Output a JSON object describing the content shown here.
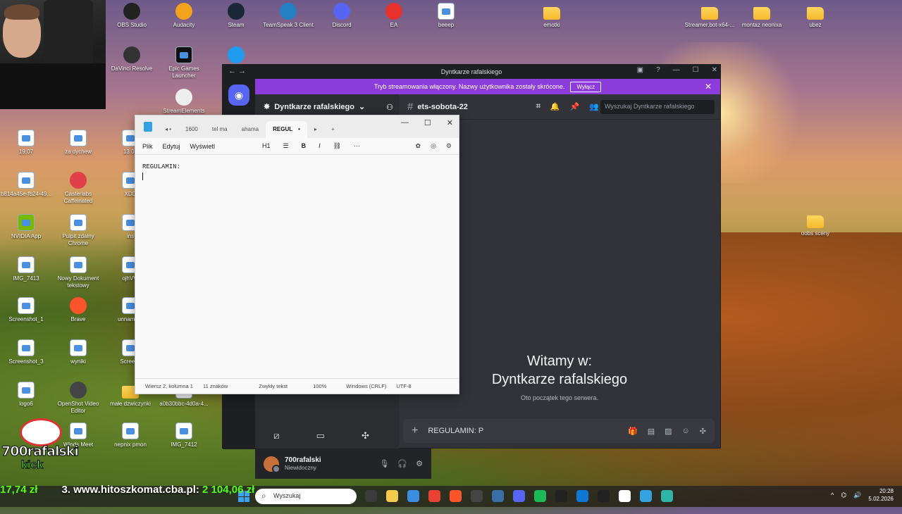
{
  "desktop": {
    "icons": [
      {
        "label": "OBS Studio",
        "kind": "round",
        "color": "#222"
      },
      {
        "label": "Audacity",
        "kind": "round",
        "color": "#f3a21b"
      },
      {
        "label": "Steam",
        "kind": "round",
        "color": "#1b2838"
      },
      {
        "label": "TeamSpeak 3 Client",
        "kind": "round",
        "color": "#2580c3"
      },
      {
        "label": "Discord",
        "kind": "round",
        "color": "#5865f2"
      },
      {
        "label": "EA",
        "kind": "round",
        "color": "#e5322d"
      },
      {
        "label": "beeep",
        "kind": "file",
        "color": "#fff"
      },
      {
        "label": "emotki",
        "kind": "folder",
        "color": ""
      },
      {
        "label": "Streamer.bot-x64-...",
        "kind": "folder",
        "color": ""
      },
      {
        "label": "montaz neonixa",
        "kind": "folder",
        "color": ""
      },
      {
        "label": "ubez",
        "kind": "folder",
        "color": ""
      },
      {
        "label": "DaVinci Resolve",
        "kind": "round",
        "color": "#333"
      },
      {
        "label": "Epic Games Launcher",
        "kind": "file",
        "color": "#111"
      },
      {
        "label": "Restream",
        "kind": "round",
        "color": "#1f9cf0"
      },
      {
        "label": "StreamElements SE.Live",
        "kind": "round",
        "color": "#eee"
      },
      {
        "label": "19,07",
        "kind": "file",
        "color": ""
      },
      {
        "label": "za dychew",
        "kind": "file",
        "color": ""
      },
      {
        "label": "13.08",
        "kind": "file",
        "color": ""
      },
      {
        "label": "b814a45e-fb24-49...",
        "kind": "file",
        "color": ""
      },
      {
        "label": "Casterlabs Caffeinated",
        "kind": "round",
        "color": "#e0404a"
      },
      {
        "label": "XDD",
        "kind": "file",
        "color": ""
      },
      {
        "label": "NVIDIA App",
        "kind": "file",
        "color": "#76b900"
      },
      {
        "label": "Pulpit zdalny Chrome",
        "kind": "file",
        "color": ""
      },
      {
        "label": "ins",
        "kind": "file",
        "color": ""
      },
      {
        "label": "IMG_7413",
        "kind": "file",
        "color": ""
      },
      {
        "label": "Nowy Dokument tekstowy",
        "kind": "file",
        "color": ""
      },
      {
        "label": "ojhVVI",
        "kind": "file",
        "color": ""
      },
      {
        "label": "Screenshot_1",
        "kind": "file",
        "color": ""
      },
      {
        "label": "Brave",
        "kind": "round",
        "color": "#fb542b"
      },
      {
        "label": "unnamed-",
        "kind": "file",
        "color": ""
      },
      {
        "label": "Screenshot_3",
        "kind": "file",
        "color": ""
      },
      {
        "label": "wyniki",
        "kind": "file",
        "color": ""
      },
      {
        "label": "Screens",
        "kind": "file",
        "color": ""
      },
      {
        "label": "logo6",
        "kind": "file",
        "color": ""
      },
      {
        "label": "OpenShot Video Editor",
        "kind": "round",
        "color": "#444"
      },
      {
        "label": "małe dzwiczynki",
        "kind": "folder",
        "color": ""
      },
      {
        "label": "a0b30bbc-4d0a-4...",
        "kind": "file",
        "color": ""
      },
      {
        "label": "Winds Meet",
        "kind": "file",
        "color": ""
      },
      {
        "label": "nepnix pmon",
        "kind": "file",
        "color": ""
      },
      {
        "label": "IMG_7412",
        "kind": "file",
        "color": ""
      },
      {
        "label": "oobs sceny",
        "kind": "folder",
        "color": ""
      }
    ]
  },
  "discord": {
    "window_title": "Dyntkarze rafalskiego",
    "banner_text": "Tryb streamowania włączony. Nazwy użytkownika zostały skrócone.",
    "banner_button": "Wyłącz",
    "server_name": "Dyntkarze rafalskiego",
    "channel_name": "ets-sobota-22",
    "search_placeholder": "Wyszukaj Dyntkarze rafalskiego",
    "welcome_line1": "Witamy w:",
    "welcome_line2": "Dyntkarze rafalskiego",
    "welcome_sub": "Oto początek tego serwera.",
    "user_name": "700rafalski",
    "user_status": "Niewidoczny",
    "message_input": "REGULAMIN: P"
  },
  "notepad": {
    "tabs": [
      "1600",
      "tel ma",
      "ahama",
      "REGUL"
    ],
    "active_tab": "REGUL",
    "menu": [
      "Plik",
      "Edytuj",
      "Wyświetl"
    ],
    "heading_select": "H1",
    "content": "REGULAMIN:",
    "status": {
      "position": "Wiersz 2, kolumna 1",
      "chars": "11 znaków",
      "format": "Zwykły tekst",
      "zoom": "100%",
      "line_endings": "Windows (CRLF)",
      "encoding": "UTF-8"
    }
  },
  "overlay": {
    "channel_name": "700rafalski",
    "platform": "kick",
    "ticker_left": "17,74 zł",
    "ticker_site": "3. www.hitoszkomat.cba.pl:",
    "ticker_amount": "2 104,06 zł"
  },
  "taskbar": {
    "search_placeholder": "Wyszukaj",
    "time": "20:28",
    "date": "5.02.2026",
    "apps": [
      "#3b3b3b",
      "#f2c94c",
      "#3a8de0",
      "#e94235",
      "#fb542b",
      "#444",
      "#3a6ea5",
      "#5865f2",
      "#1db954",
      "#222",
      "#0e78d4",
      "#222",
      "#ffffff",
      "#35a2e0",
      "#2fb5a8"
    ]
  }
}
